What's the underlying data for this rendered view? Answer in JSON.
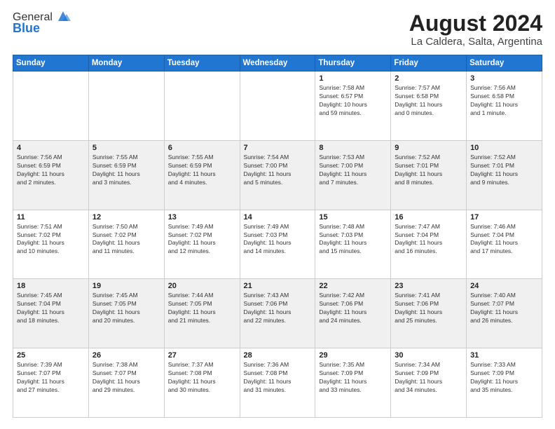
{
  "logo": {
    "general": "General",
    "blue": "Blue"
  },
  "title": "August 2024",
  "subtitle": "La Caldera, Salta, Argentina",
  "headers": [
    "Sunday",
    "Monday",
    "Tuesday",
    "Wednesday",
    "Thursday",
    "Friday",
    "Saturday"
  ],
  "weeks": [
    [
      {
        "day": "",
        "info": ""
      },
      {
        "day": "",
        "info": ""
      },
      {
        "day": "",
        "info": ""
      },
      {
        "day": "",
        "info": ""
      },
      {
        "day": "1",
        "info": "Sunrise: 7:58 AM\nSunset: 6:57 PM\nDaylight: 10 hours\nand 59 minutes."
      },
      {
        "day": "2",
        "info": "Sunrise: 7:57 AM\nSunset: 6:58 PM\nDaylight: 11 hours\nand 0 minutes."
      },
      {
        "day": "3",
        "info": "Sunrise: 7:56 AM\nSunset: 6:58 PM\nDaylight: 11 hours\nand 1 minute."
      }
    ],
    [
      {
        "day": "4",
        "info": "Sunrise: 7:56 AM\nSunset: 6:59 PM\nDaylight: 11 hours\nand 2 minutes."
      },
      {
        "day": "5",
        "info": "Sunrise: 7:55 AM\nSunset: 6:59 PM\nDaylight: 11 hours\nand 3 minutes."
      },
      {
        "day": "6",
        "info": "Sunrise: 7:55 AM\nSunset: 6:59 PM\nDaylight: 11 hours\nand 4 minutes."
      },
      {
        "day": "7",
        "info": "Sunrise: 7:54 AM\nSunset: 7:00 PM\nDaylight: 11 hours\nand 5 minutes."
      },
      {
        "day": "8",
        "info": "Sunrise: 7:53 AM\nSunset: 7:00 PM\nDaylight: 11 hours\nand 7 minutes."
      },
      {
        "day": "9",
        "info": "Sunrise: 7:52 AM\nSunset: 7:01 PM\nDaylight: 11 hours\nand 8 minutes."
      },
      {
        "day": "10",
        "info": "Sunrise: 7:52 AM\nSunset: 7:01 PM\nDaylight: 11 hours\nand 9 minutes."
      }
    ],
    [
      {
        "day": "11",
        "info": "Sunrise: 7:51 AM\nSunset: 7:02 PM\nDaylight: 11 hours\nand 10 minutes."
      },
      {
        "day": "12",
        "info": "Sunrise: 7:50 AM\nSunset: 7:02 PM\nDaylight: 11 hours\nand 11 minutes."
      },
      {
        "day": "13",
        "info": "Sunrise: 7:49 AM\nSunset: 7:02 PM\nDaylight: 11 hours\nand 12 minutes."
      },
      {
        "day": "14",
        "info": "Sunrise: 7:49 AM\nSunset: 7:03 PM\nDaylight: 11 hours\nand 14 minutes."
      },
      {
        "day": "15",
        "info": "Sunrise: 7:48 AM\nSunset: 7:03 PM\nDaylight: 11 hours\nand 15 minutes."
      },
      {
        "day": "16",
        "info": "Sunrise: 7:47 AM\nSunset: 7:04 PM\nDaylight: 11 hours\nand 16 minutes."
      },
      {
        "day": "17",
        "info": "Sunrise: 7:46 AM\nSunset: 7:04 PM\nDaylight: 11 hours\nand 17 minutes."
      }
    ],
    [
      {
        "day": "18",
        "info": "Sunrise: 7:45 AM\nSunset: 7:04 PM\nDaylight: 11 hours\nand 18 minutes."
      },
      {
        "day": "19",
        "info": "Sunrise: 7:45 AM\nSunset: 7:05 PM\nDaylight: 11 hours\nand 20 minutes."
      },
      {
        "day": "20",
        "info": "Sunrise: 7:44 AM\nSunset: 7:05 PM\nDaylight: 11 hours\nand 21 minutes."
      },
      {
        "day": "21",
        "info": "Sunrise: 7:43 AM\nSunset: 7:06 PM\nDaylight: 11 hours\nand 22 minutes."
      },
      {
        "day": "22",
        "info": "Sunrise: 7:42 AM\nSunset: 7:06 PM\nDaylight: 11 hours\nand 24 minutes."
      },
      {
        "day": "23",
        "info": "Sunrise: 7:41 AM\nSunset: 7:06 PM\nDaylight: 11 hours\nand 25 minutes."
      },
      {
        "day": "24",
        "info": "Sunrise: 7:40 AM\nSunset: 7:07 PM\nDaylight: 11 hours\nand 26 minutes."
      }
    ],
    [
      {
        "day": "25",
        "info": "Sunrise: 7:39 AM\nSunset: 7:07 PM\nDaylight: 11 hours\nand 27 minutes."
      },
      {
        "day": "26",
        "info": "Sunrise: 7:38 AM\nSunset: 7:07 PM\nDaylight: 11 hours\nand 29 minutes."
      },
      {
        "day": "27",
        "info": "Sunrise: 7:37 AM\nSunset: 7:08 PM\nDaylight: 11 hours\nand 30 minutes."
      },
      {
        "day": "28",
        "info": "Sunrise: 7:36 AM\nSunset: 7:08 PM\nDaylight: 11 hours\nand 31 minutes."
      },
      {
        "day": "29",
        "info": "Sunrise: 7:35 AM\nSunset: 7:09 PM\nDaylight: 11 hours\nand 33 minutes."
      },
      {
        "day": "30",
        "info": "Sunrise: 7:34 AM\nSunset: 7:09 PM\nDaylight: 11 hours\nand 34 minutes."
      },
      {
        "day": "31",
        "info": "Sunrise: 7:33 AM\nSunset: 7:09 PM\nDaylight: 11 hours\nand 35 minutes."
      }
    ]
  ]
}
